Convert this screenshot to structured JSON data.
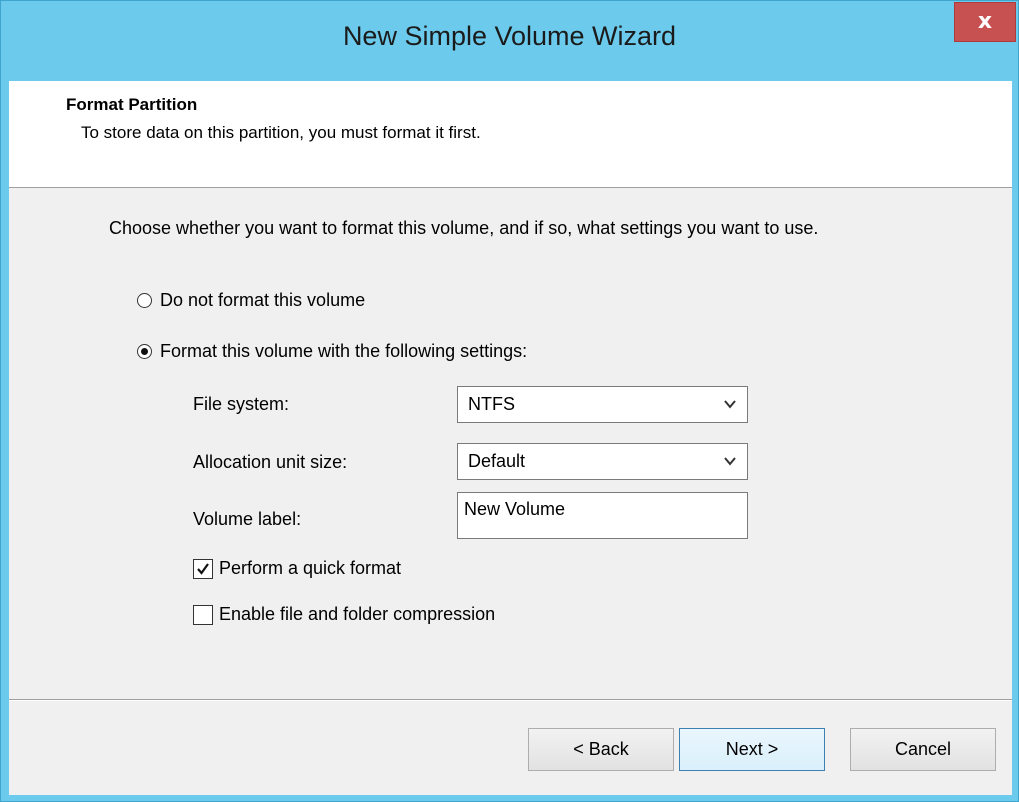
{
  "window": {
    "title": "New Simple Volume Wizard",
    "close_glyph": "x"
  },
  "header": {
    "title": "Format Partition",
    "subtitle": "To store data on this partition, you must format it first."
  },
  "body": {
    "intro": "Choose whether you want to format this volume, and if so, what settings you want to use.",
    "options": [
      {
        "label": "Do not format this volume",
        "selected": false
      },
      {
        "label": "Format this volume with the following settings:",
        "selected": true
      }
    ],
    "fields": {
      "file_system": {
        "label": "File system:",
        "value": "NTFS"
      },
      "allocation_unit_size": {
        "label": "Allocation unit size:",
        "value": "Default"
      },
      "volume_label": {
        "label": "Volume label:",
        "value": "New Volume"
      }
    },
    "checkboxes": [
      {
        "label": "Perform a quick format",
        "checked": true
      },
      {
        "label": "Enable file and folder compression",
        "checked": false
      }
    ]
  },
  "buttons": {
    "back": "< Back",
    "next": "Next >",
    "cancel": "Cancel"
  },
  "icons": {
    "dropdown": "chevron-down-icon",
    "close": "close-icon",
    "check": "checkmark-icon"
  },
  "colors": {
    "titlebar": "#6ccbed",
    "close_button": "#c75050",
    "client_background": "#f0f0f0",
    "header_background": "#ffffff"
  }
}
